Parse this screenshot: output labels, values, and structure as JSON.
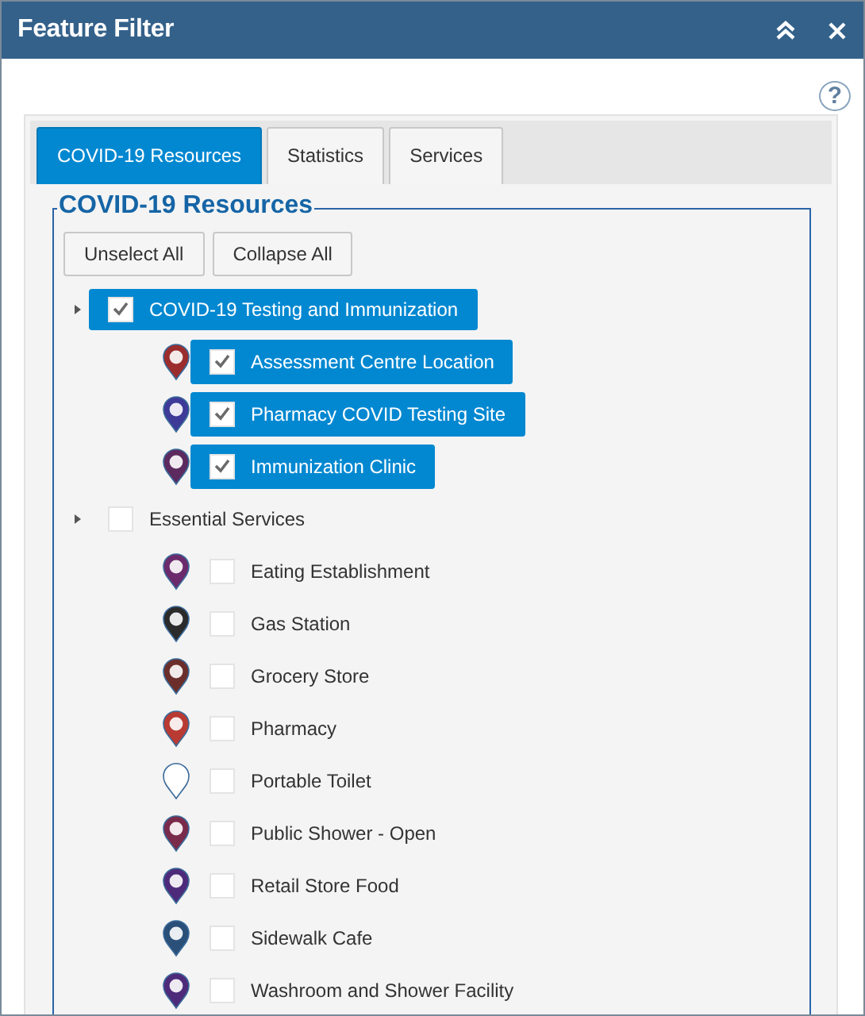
{
  "window": {
    "title": "Feature Filter"
  },
  "help": "?",
  "tabs": [
    {
      "label": "COVID-19 Resources",
      "selected": true
    },
    {
      "label": "Statistics",
      "selected": false
    },
    {
      "label": "Services",
      "selected": false
    }
  ],
  "section": {
    "title": "COVID-19 Resources",
    "buttons": [
      "Unselect All",
      "Collapse All"
    ]
  },
  "tree": [
    {
      "label": "COVID-19 Testing and Immunization",
      "checked": true,
      "children": [
        {
          "label": "Assessment Centre Location",
          "checked": true,
          "color": "#9b2d2d"
        },
        {
          "label": "Pharmacy COVID Testing Site",
          "checked": true,
          "color": "#3d3a98"
        },
        {
          "label": "Immunization Clinic",
          "checked": true,
          "color": "#5c2a5e"
        }
      ]
    },
    {
      "label": "Essential Services",
      "checked": false,
      "children": [
        {
          "label": "Eating Establishment",
          "checked": false,
          "color": "#6b2a6b"
        },
        {
          "label": "Gas Station",
          "checked": false,
          "color": "#2b2b2b"
        },
        {
          "label": "Grocery Store",
          "checked": false,
          "color": "#6b2e2a"
        },
        {
          "label": "Pharmacy",
          "checked": false,
          "color": "#b83a32"
        },
        {
          "label": "Portable Toilet",
          "checked": false,
          "color": "#ffffff"
        },
        {
          "label": "Public Shower - Open",
          "checked": false,
          "color": "#7a2a4a"
        },
        {
          "label": "Retail Store Food",
          "checked": false,
          "color": "#4e2a7a"
        },
        {
          "label": "Sidewalk Cafe",
          "checked": false,
          "color": "#2a4f78"
        },
        {
          "label": "Washroom and Shower Facility",
          "checked": false,
          "color": "#4e2a7a"
        }
      ]
    }
  ]
}
